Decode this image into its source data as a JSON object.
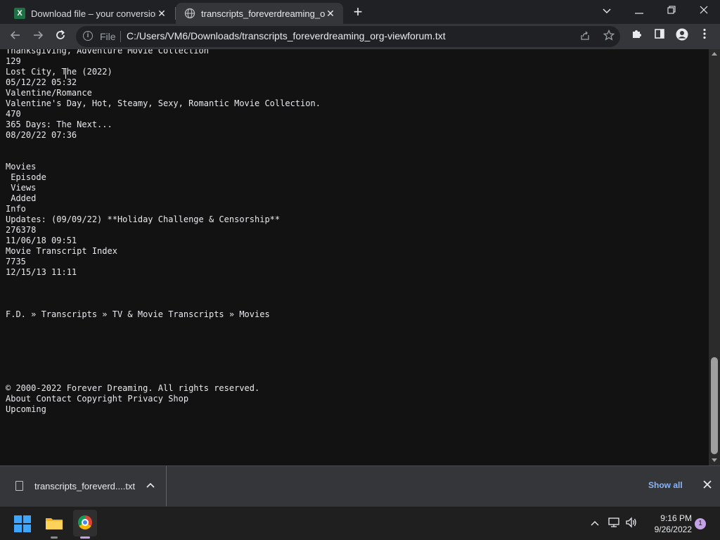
{
  "browser": {
    "tabs": [
      {
        "title": "Download file – your conversion",
        "icon": "excel-icon",
        "active": false
      },
      {
        "title": "transcripts_foreverdreaming_org",
        "icon": "globe-icon",
        "active": true
      }
    ],
    "omnibox": {
      "scheme_label": "File",
      "url": "C:/Users/VM6/Downloads/transcripts_foreverdreaming_org-viewforum.txt"
    }
  },
  "page": {
    "lines": [
      "Thanksgiving, Adventure Movie Collection",
      "129",
      "Lost City, The (2022)",
      "05/12/22 05:32",
      "Valentine/Romance",
      "Valentine's Day, Hot, Steamy, Sexy, Romantic Movie Collection.",
      "470",
      "365 Days: The Next...",
      "08/20/22 07:36",
      "",
      "",
      "Movies",
      " Episode",
      " Views",
      " Added",
      "Info",
      "Updates: (09/09/22) **Holiday Challenge & Censorship**",
      "276378",
      "11/06/18 09:51",
      "Movie Transcript Index",
      "7735",
      "12/15/13 11:11",
      "",
      "",
      "",
      "F.D. » Transcripts » TV & Movie Transcripts » Movies",
      "",
      "",
      "",
      "",
      "",
      "",
      "© 2000-2022 Forever Dreaming. All rights reserved.",
      "About Contact Copyright Privacy Shop",
      "Upcoming"
    ]
  },
  "download_shelf": {
    "item_name": "transcripts_foreverd....txt",
    "show_all": "Show all"
  },
  "taskbar": {
    "time": "9:16 PM",
    "date": "9/26/2022",
    "notification_count": "1"
  }
}
